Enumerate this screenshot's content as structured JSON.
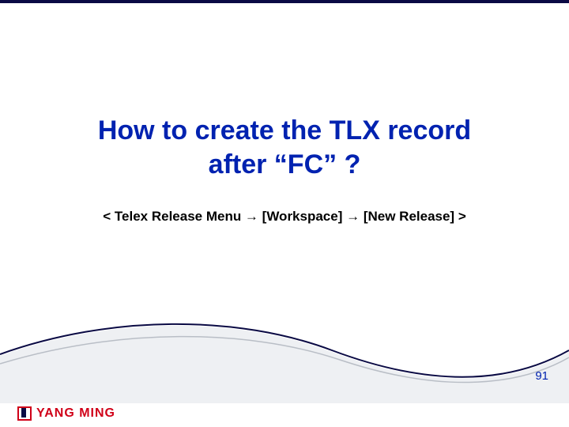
{
  "title_line1": "How to create the TLX record",
  "title_line2": "after “FC” ?",
  "subtitle": "< Telex Release Menu → [Workspace] → [New Release] >",
  "page_number": "91",
  "logo_text": "YANG MING",
  "colors": {
    "title": "#0022b0",
    "accent_navy": "#0a0a44",
    "accent_red": "#d00018"
  }
}
